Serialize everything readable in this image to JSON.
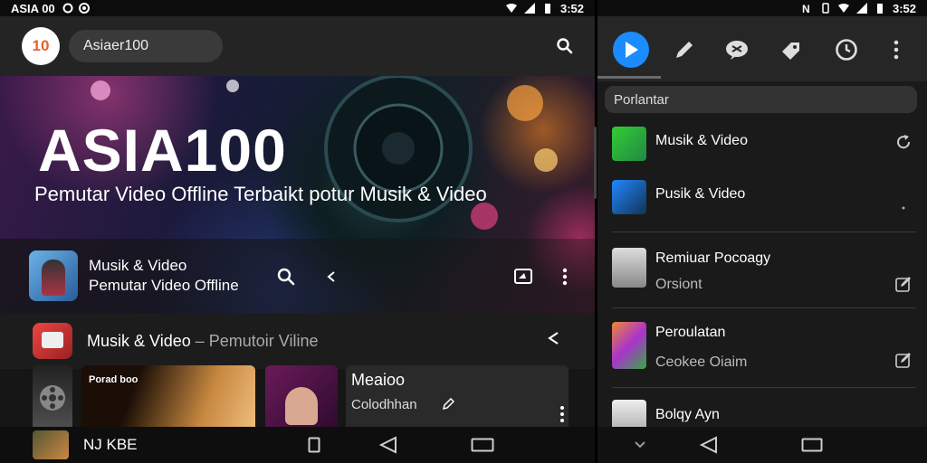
{
  "left": {
    "statusbar": {
      "app": "ASIA 00",
      "time": "3:52"
    },
    "appbar": {
      "logo_text": "10",
      "search_value": "Asiaer100"
    },
    "hero": {
      "title": "ASIA100",
      "subtitle": "Pemutar Video Offline Terbaikt potur Musik & Video"
    },
    "now_playing": {
      "title": "Musik & Video",
      "subtitle": "Pemutar Video Offline"
    },
    "section": {
      "title": "Musik & Video",
      "separator": " – ",
      "subtitle": "Pemutoir Viline"
    },
    "cards": [
      {
        "label": "Porad boo"
      },
      {
        "meta_title": "Meaioo",
        "meta_sub": "Colodhhan"
      }
    ],
    "bottom": {
      "label": "NJ KBE"
    }
  },
  "right": {
    "statusbar": {
      "time": "3:52"
    },
    "search_placeholder": "Porlantar",
    "items": [
      {
        "title": "Musik & Video",
        "subtitle": "",
        "action_icon": "refresh-icon"
      },
      {
        "title": "Pusik & Video",
        "subtitle": "",
        "action_icon": "dot-icon"
      },
      {
        "title": "Remiuar Pocoagy",
        "subtitle": "Orsiont",
        "action_icon": "edit-icon"
      },
      {
        "title": "Peroulatan",
        "subtitle": "Ceokee Oiaim",
        "action_icon": "edit-icon"
      },
      {
        "title": "Bolqy Ayn",
        "subtitle": "",
        "action_icon": ""
      }
    ]
  },
  "colors": {
    "accent": "#1a8cff",
    "background": "#161616",
    "bar": "#242424"
  }
}
